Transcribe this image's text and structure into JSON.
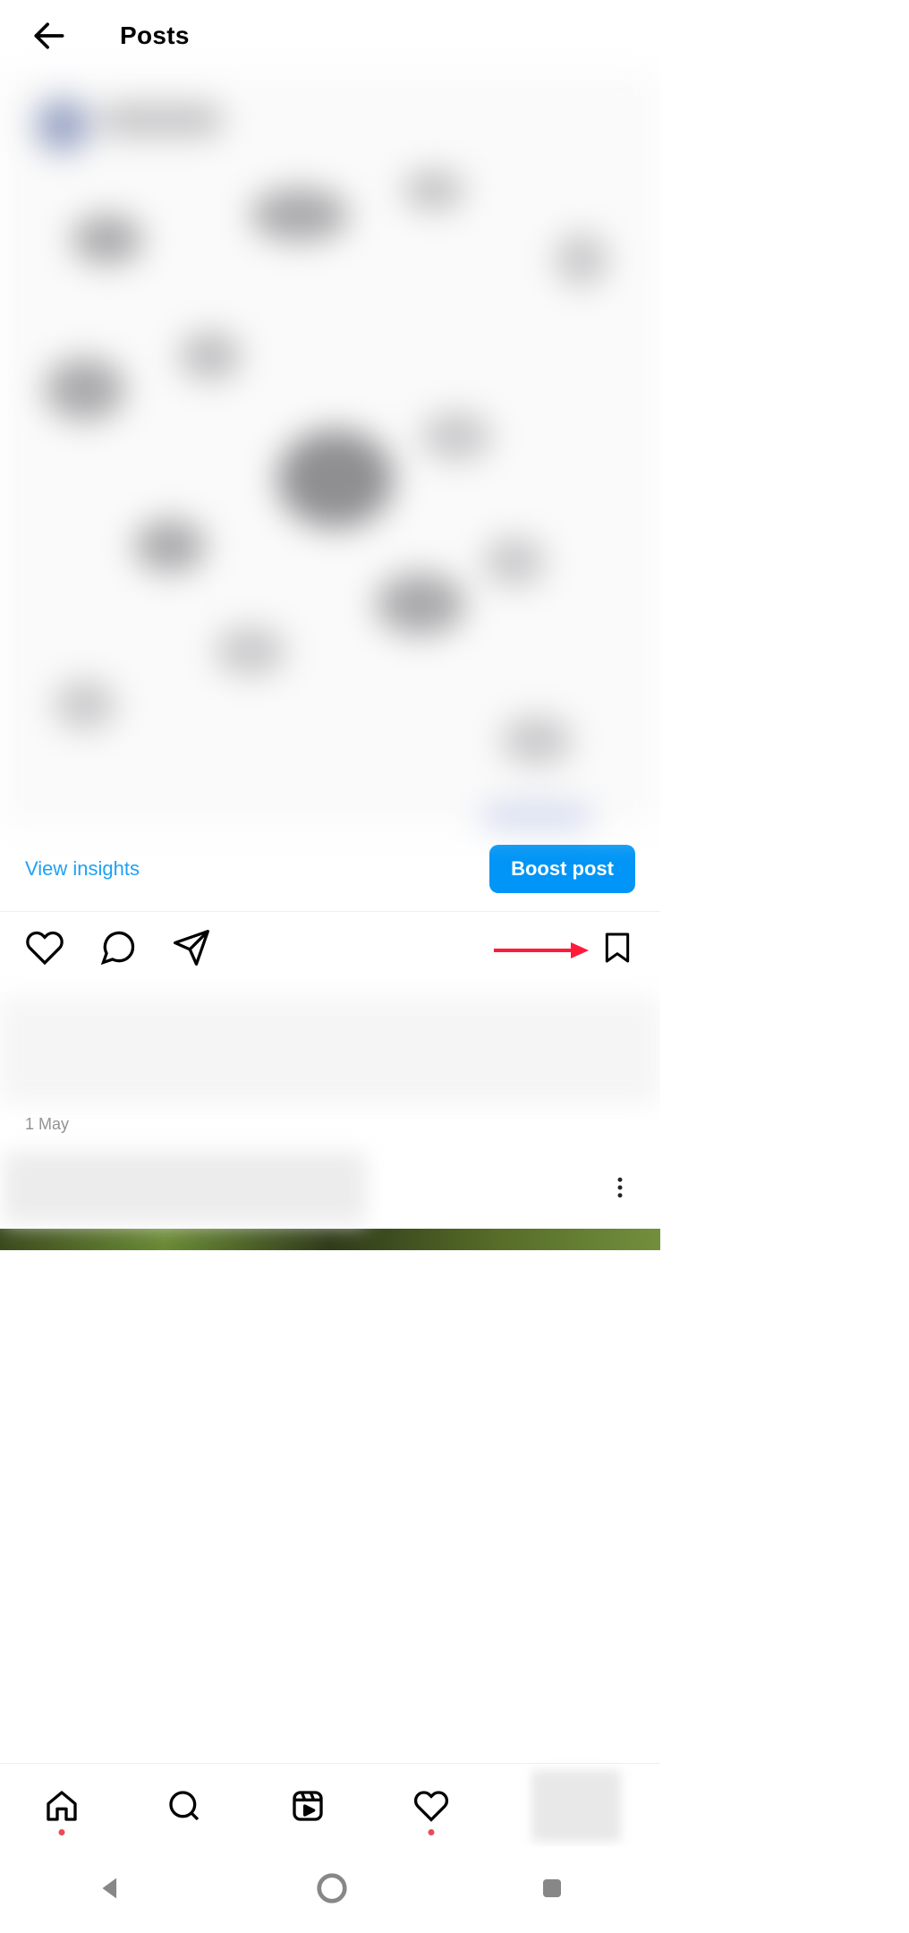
{
  "header": {
    "title": "Posts"
  },
  "post": {
    "insights_label": "View insights",
    "boost_label": "Boost post",
    "date": "1 May"
  },
  "icons": {
    "back": "arrow-left-icon",
    "like": "heart-icon",
    "comment": "comment-icon",
    "share": "send-icon",
    "save": "bookmark-icon",
    "more": "more-vertical-icon"
  },
  "nav": {
    "home": "home-icon",
    "search": "search-icon",
    "reels": "reels-icon",
    "activity": "heart-icon",
    "profile": "profile-thumb"
  },
  "system": {
    "back": "triangle-back-icon",
    "home": "circle-home-icon",
    "recents": "square-recents-icon"
  },
  "annotation": {
    "arrow_color": "#ff1a3c",
    "points_to": "save-button"
  }
}
